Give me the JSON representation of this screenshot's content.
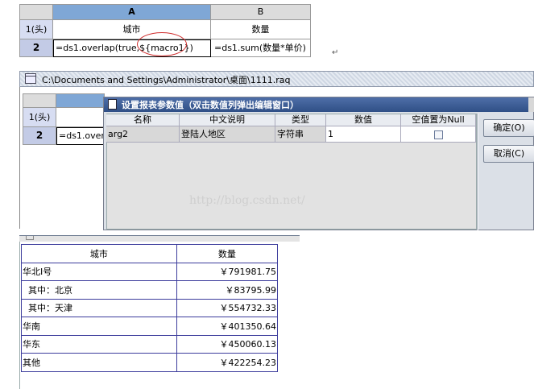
{
  "designer": {
    "column_headers": [
      "A",
      "B"
    ],
    "row_headers": [
      "1(头)",
      "2"
    ],
    "row1": {
      "a": "城市",
      "b": "数量"
    },
    "row2": {
      "a": "=ds1.overlap(true,${macro1})",
      "b": "=ds1.sum(数量*单价)"
    },
    "return_mark": "↵"
  },
  "window": {
    "title": "C:\\Documents and Settings\\Administrator\\桌面\\1111.raq",
    "row_headers": [
      "1(头)",
      "2"
    ],
    "row2_a": "=ds1.overl"
  },
  "dialog": {
    "title": "设置报表参数值（双击数值列弹出编辑窗口）",
    "columns": [
      "名称",
      "中文说明",
      "类型",
      "数值",
      "空值置为Null"
    ],
    "row": {
      "name": "arg2",
      "desc": "登陆人地区",
      "type": "字符串",
      "value": "1",
      "null_checked": false
    },
    "ok_label": "确定(O)",
    "cancel_label": "取消(C)",
    "watermark": "http://blog.csdn.net/"
  },
  "result": {
    "headers": [
      "城市",
      "数量"
    ],
    "rows": [
      {
        "city": "华北I号",
        "qty": "￥791981.75"
      },
      {
        "city": "  其中：北京",
        "qty": "￥83795.99"
      },
      {
        "city": "  其中：天津",
        "qty": "￥554732.33"
      },
      {
        "city": "华南",
        "qty": "￥401350.64"
      },
      {
        "city": "华东",
        "qty": "￥450060.13"
      },
      {
        "city": "其他",
        "qty": "￥422254.23"
      }
    ]
  }
}
